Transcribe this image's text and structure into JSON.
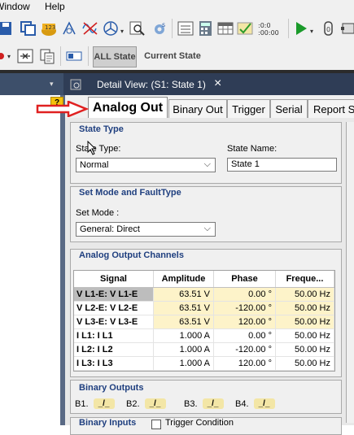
{
  "menu": {
    "window": "Window",
    "help": "Help"
  },
  "toolbar2": {
    "all_state": "ALL State",
    "current_state": "Current State"
  },
  "help_badge": "?",
  "document_tab": {
    "title": "Detail View: (S1: State 1)",
    "close": "×"
  },
  "tabs": [
    "Analog Out",
    "Binary Out",
    "Trigger",
    "Serial",
    "Report S"
  ],
  "state_type": {
    "group_title": "State Type",
    "type_label": "State Type:",
    "type_value": "Normal",
    "name_label": "State Name:",
    "name_value": "State 1"
  },
  "set_mode": {
    "group_title": "Set Mode and FaultType",
    "mode_label": "Set Mode :",
    "mode_value": "General: Direct"
  },
  "analog_channels": {
    "group_title": "Analog Output Channels",
    "columns": [
      "Signal",
      "Amplitude",
      "Phase",
      "Freque..."
    ],
    "rows": [
      {
        "signal": "V L1-E: V L1-E",
        "amplitude": "63.51 V",
        "phase": "0.00 °",
        "frequency": "50.00 Hz"
      },
      {
        "signal": "V L2-E: V L2-E",
        "amplitude": "63.51 V",
        "phase": "-120.00 °",
        "frequency": "50.00 Hz"
      },
      {
        "signal": "V L3-E: V L3-E",
        "amplitude": "63.51 V",
        "phase": "120.00 °",
        "frequency": "50.00 Hz"
      },
      {
        "signal": "I L1: I L1",
        "amplitude": "1.000 A",
        "phase": "0.00 °",
        "frequency": "50.00 Hz"
      },
      {
        "signal": "I L2: I L2",
        "amplitude": "1.000 A",
        "phase": "-120.00 °",
        "frequency": "50.00 Hz"
      },
      {
        "signal": "I L3: I L3",
        "amplitude": "1.000 A",
        "phase": "120.00 °",
        "frequency": "50.00 Hz"
      }
    ]
  },
  "binary_outputs": {
    "group_title": "Binary Outputs",
    "items": [
      {
        "label": "B1.",
        "symbol": "_/_"
      },
      {
        "label": "B2.",
        "symbol": "_/_"
      },
      {
        "label": "B3.",
        "symbol": "_/_"
      },
      {
        "label": "B4.",
        "symbol": "_/_"
      }
    ]
  },
  "binary_inputs": {
    "group_title": "Binary Inputs",
    "trigger_label": "Trigger Condition"
  },
  "colors": {
    "group_title": "#1f3f7f",
    "arrow": "#e02020",
    "dark_header": "#2f3d56",
    "row_highlight": "#fdf3c9",
    "play_green": "#1a9a2a"
  }
}
